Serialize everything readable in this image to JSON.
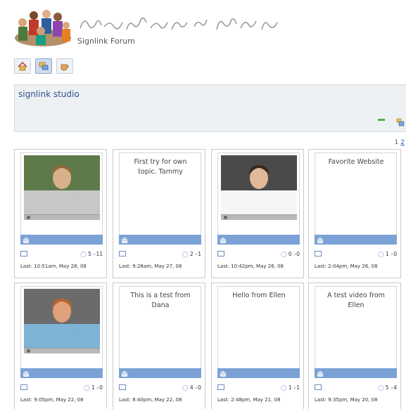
{
  "header": {
    "forum_name": "Signlink Forum"
  },
  "toolbar": {
    "buttons": [
      {
        "icon": "home-icon"
      },
      {
        "icon": "discussion-icon",
        "active": true
      },
      {
        "icon": "coffee-icon"
      }
    ]
  },
  "studio": {
    "title": "signlink studio"
  },
  "pager": {
    "current": "1",
    "next": "2"
  },
  "cards": [
    {
      "type": "video",
      "replies": "5",
      "views": "11",
      "last": "Last: 10:51am, May 28, 08"
    },
    {
      "type": "text",
      "text": "First try for own topic. Tammy",
      "replies": "2",
      "views": "1",
      "last": "Last: 9:28am, May 27, 08"
    },
    {
      "type": "video",
      "replies": "0",
      "views": "0",
      "last": "Last: 10:42pm, May 26, 08"
    },
    {
      "type": "text",
      "text": "Favorite Website",
      "replies": "1",
      "views": "0",
      "last": "Last: 2:04pm, May 26, 08"
    },
    {
      "type": "video",
      "replies": "1",
      "views": "0",
      "last": "Last: 9:05pm, May 22, 08"
    },
    {
      "type": "text",
      "text": "This is a test from Dana",
      "replies": "4",
      "views": "0",
      "last": "Last: 8:40pm, May 22, 08"
    },
    {
      "type": "text",
      "text": "Hello from Ellen",
      "replies": "1",
      "views": "1",
      "last": "Last: 2:48pm, May 21, 08"
    },
    {
      "type": "text",
      "text": "A test video from Ellen",
      "replies": "5",
      "views": "4",
      "last": "Last: 9:35pm, May 20, 08"
    }
  ],
  "colors": {
    "accent": "#7ba2d6",
    "title_blue": "#2f4f8f",
    "panel_bg": "#eef1f3"
  }
}
